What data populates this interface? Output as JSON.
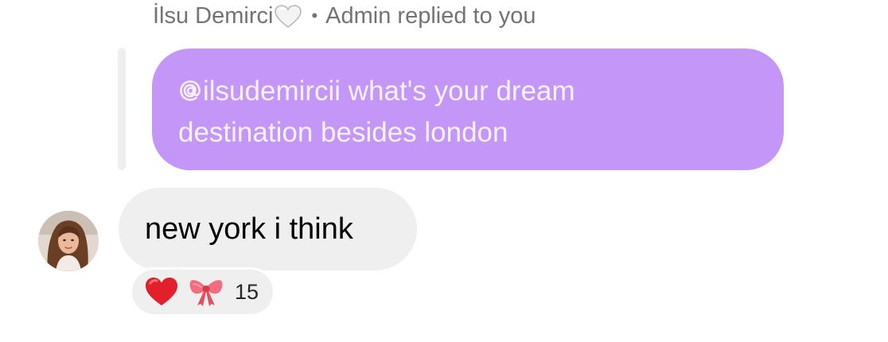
{
  "reply_header": {
    "sender_name": "İlsu Demirci",
    "sender_name_emoji": "white-heart-icon",
    "separator": "•",
    "action_text": "Admin replied to you"
  },
  "quoted_message": {
    "mention_icon": "threads-at-icon",
    "text": "ilsudemircii what's your dream destination besides london",
    "bubble_color": "#c496f8"
  },
  "message": {
    "avatar": "profile-avatar",
    "text": "new york i think",
    "bubble_color": "#efefef"
  },
  "reactions": {
    "emojis": [
      "red-heart-icon",
      "ribbon-icon"
    ],
    "count": "15"
  }
}
